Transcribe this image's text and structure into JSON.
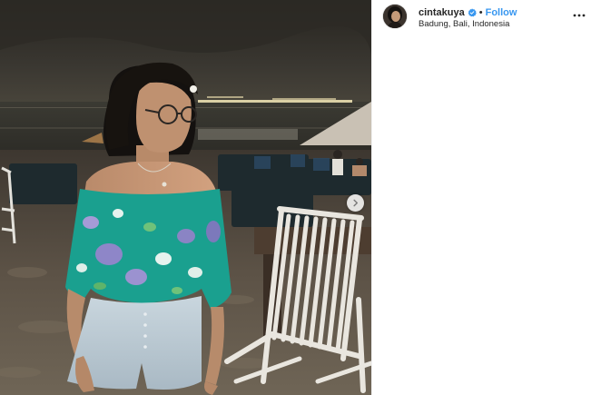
{
  "post": {
    "author": {
      "username": "cintakuya",
      "verified": true,
      "verified_icon": "verified-badge-icon",
      "avatar_icon": "profile-avatar"
    },
    "separator": "•",
    "follow_label": "Follow",
    "location": "Badung, Bali, Indonesia",
    "more_icon": "more-options-icon",
    "photo": {
      "alt": "Girl in teal floral off-shoulder top standing on beach at night",
      "carousel_next_icon": "chevron-right-icon"
    }
  },
  "colors": {
    "accent": "#3897f0",
    "text": "#262626",
    "verified": "#3897f0",
    "background": "#ffffff"
  }
}
